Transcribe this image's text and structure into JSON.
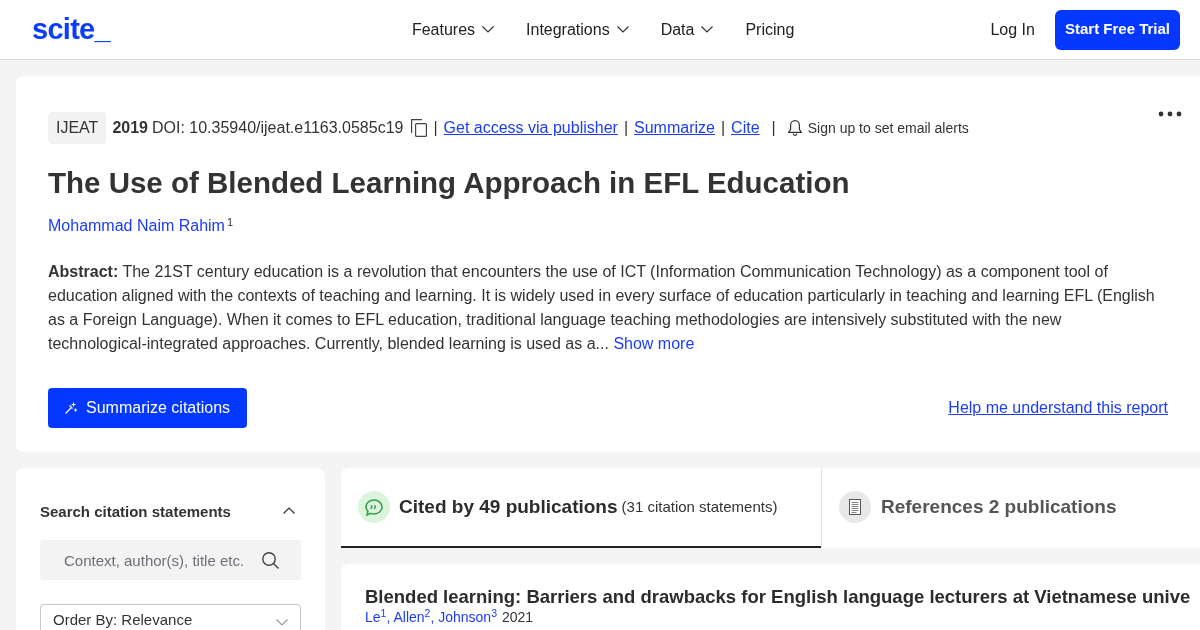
{
  "header": {
    "logo": "scite_",
    "nav": [
      {
        "label": "Features",
        "dropdown": true
      },
      {
        "label": "Integrations",
        "dropdown": true
      },
      {
        "label": "Data",
        "dropdown": true
      },
      {
        "label": "Pricing",
        "dropdown": false
      }
    ],
    "login": "Log In",
    "cta": "Start Free Trial"
  },
  "paper": {
    "journal": "IJEAT",
    "year": "2019",
    "doi": "DOI: 10.35940/ijeat.e1163.0585c19",
    "actions": [
      {
        "kind": "separator",
        "text": "|"
      },
      {
        "kind": "link",
        "text": "Get access via publisher"
      },
      {
        "kind": "separator",
        "text": "|"
      },
      {
        "kind": "link",
        "text": "Summarize"
      },
      {
        "kind": "separator",
        "text": "|"
      },
      {
        "kind": "link",
        "text": "Cite"
      },
      {
        "kind": "separator",
        "text": "|"
      },
      {
        "kind": "alert",
        "text": "Sign up to set email alerts"
      }
    ],
    "title": "The Use of Blended Learning Approach in EFL Education",
    "author": {
      "name": "Mohammad Naim Rahim",
      "affiliation": "1"
    },
    "abstract": "**Abstract:** The 21ST century education is a revolution that encounters the use of ICT (Information Communication Technology) as a component tool of education aligned with the contexts of teaching and learning. It is widely used in every surface of education particularly in teaching and learning EFL (English as a Foreign Language). When it comes to EFL education, traditional language teaching methodologies are intensively substituted with the new technological-integrated approaches. Currently, blended learning is used as a...",
    "show_more": "Show more",
    "summarize_button": "Summarize citations",
    "help_link": "Help me understand this report"
  },
  "sidebar": {
    "heading": "Search citation statements",
    "expanded": true,
    "search": {
      "placeholder": "Context, author(s), title etc."
    },
    "order_select": {
      "value": "Order By: Relevance"
    }
  },
  "tabs": [
    {
      "kind": "cited",
      "label": "Cited by 49 publications",
      "detail": "(31 citation statements)",
      "selected": true
    },
    {
      "kind": "references",
      "label": "References 2 publications",
      "selected": false
    }
  ],
  "citations": [
    {
      "title": "Blended learning: Barriers and drawbacks for English language lecturers at Vietnamese unive",
      "authors": "Le$^{1}$, Allen$^{2}$, Johnson$^{3}$",
      "year": "2021"
    }
  ]
}
